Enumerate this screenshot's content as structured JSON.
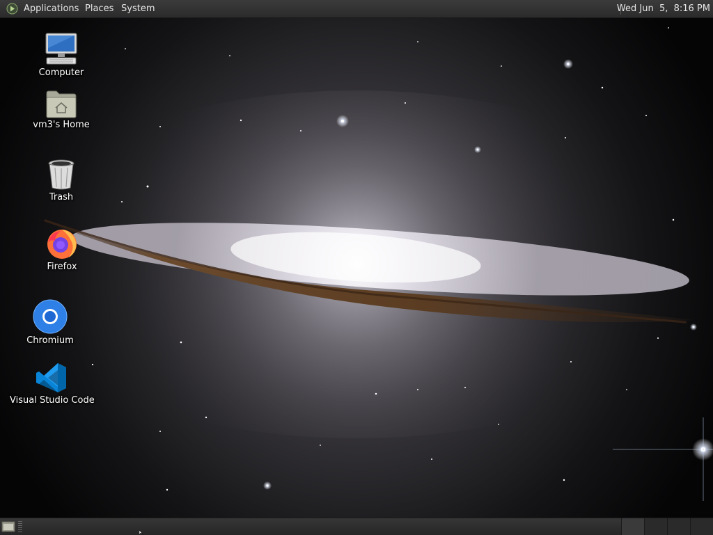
{
  "top_panel": {
    "menus": [
      "Applications",
      "Places",
      "System"
    ],
    "clock": "Wed Jun  5,  8:16 PM"
  },
  "desktop": {
    "icons": [
      {
        "label": "Computer",
        "icon": "computer-icon"
      },
      {
        "label": "vm3's Home",
        "icon": "home-folder-icon"
      },
      {
        "label": "Trash",
        "icon": "trash-icon"
      },
      {
        "label": "Firefox",
        "icon": "firefox-icon"
      },
      {
        "label": "Chromium",
        "icon": "chromium-icon"
      },
      {
        "label": "Visual Studio Code",
        "icon": "vscode-icon"
      }
    ]
  },
  "colors": {
    "panel": "#2f2f2f",
    "panel_text": "#e6e6e6",
    "desktop_label": "#ffffff",
    "firefox": "#ff7139",
    "chromium_blue": "#2e80e6",
    "vscode_blue": "#1f9cf0"
  }
}
